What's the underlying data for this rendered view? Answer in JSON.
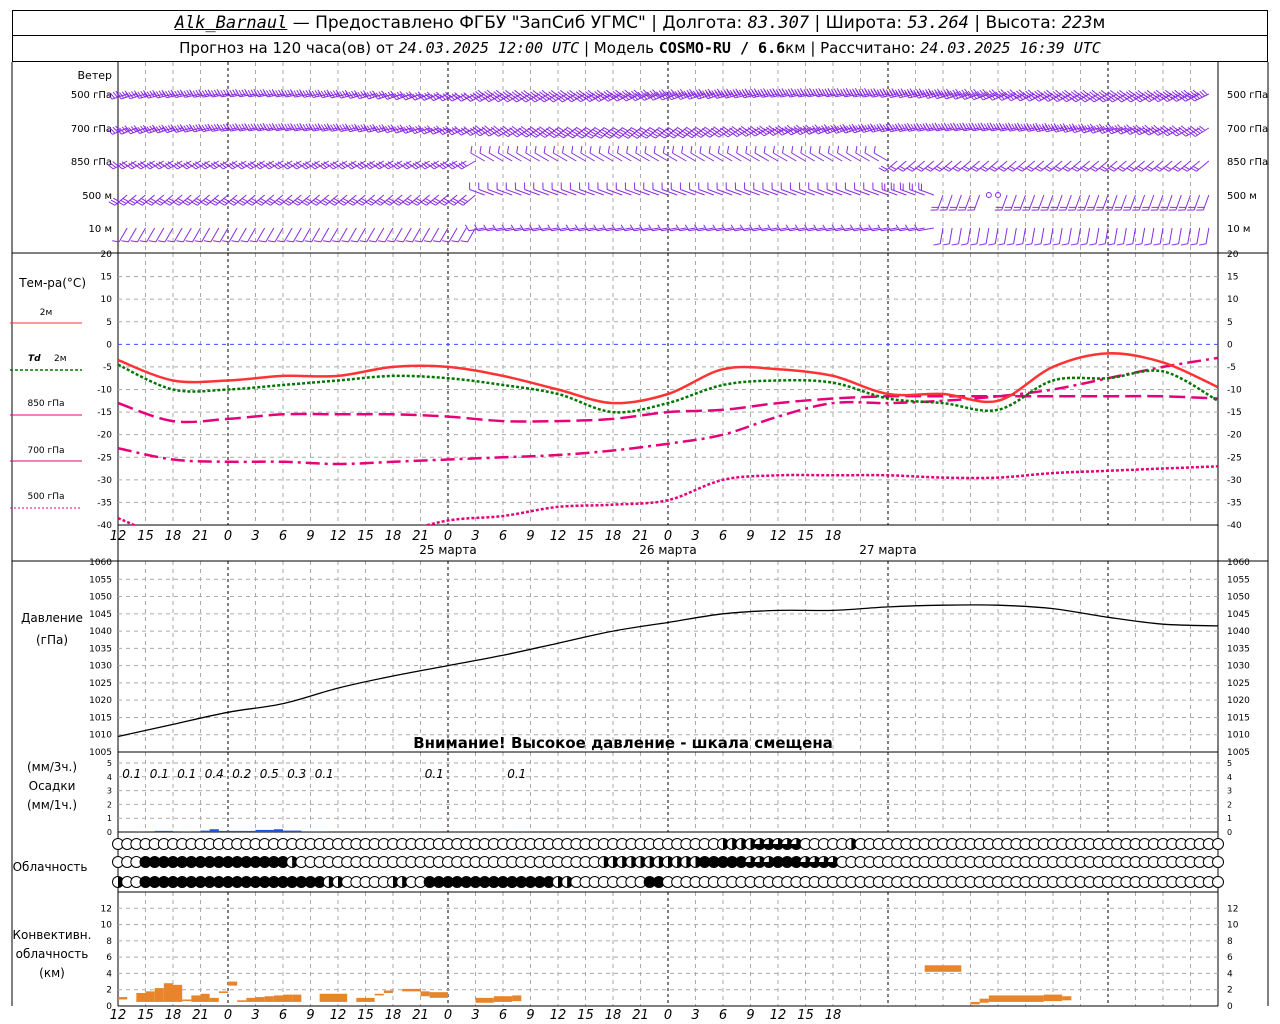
{
  "header": {
    "station": "Alk_Barnaul",
    "provider": " — Предоставлено ФГБУ \"ЗапСиб УГМС\" | Долгота: ",
    "lon": "83.307",
    "lat_label": " | Широта: ",
    "lat": "53.264",
    "alt_label": " | Высота: ",
    "alt": "223",
    "alt_unit": "м",
    "line2_a": "Прогноз на 120 часа(ов) от ",
    "start": "24.03.2025 12:00 UTC",
    "line2_b": "  | Модель ",
    "model": "COSMO-RU / 6.6",
    "model_unit": "км",
    "line2_c": " | Рассчитано: ",
    "computed": "24.03.2025 16:39 UTC"
  },
  "chart_data": [
    {
      "type": "line",
      "panel": "wind",
      "title": "Ветер",
      "levels": [
        "500 гПа",
        "700 гПа",
        "850 гПа",
        "500 м",
        "10  м"
      ]
    },
    {
      "type": "line",
      "panel": "temperature",
      "ylabel": "Тем-ра(°C)",
      "ylim": [
        -40,
        20
      ],
      "yticks": [
        20,
        15,
        10,
        5,
        0,
        -5,
        -10,
        -15,
        -20,
        -25,
        -30,
        -35,
        -40
      ],
      "x_hours": [
        0,
        6,
        12,
        18,
        24,
        30,
        36,
        42,
        48,
        54,
        60,
        66,
        72,
        78,
        84,
        90,
        96,
        102,
        108,
        114,
        120
      ],
      "series": [
        {
          "name": "2м",
          "color": "#ff3333",
          "style": "solid",
          "values": [
            -3.5,
            -8,
            -8,
            -7,
            -7,
            -5,
            -5,
            -7,
            -10,
            -13,
            -11,
            -5.5,
            -5.5,
            -7,
            -11,
            -11,
            -12.5,
            -5,
            -2,
            -4,
            -9.5
          ]
        },
        {
          "name": "Td 2м",
          "color": "#007700",
          "style": "dotted",
          "values": [
            -4.5,
            -10,
            -10,
            -9,
            -8,
            -7,
            -7.5,
            -9,
            -11,
            -15,
            -13,
            -9,
            -8,
            -8.5,
            -12,
            -13,
            -14.5,
            -8,
            -7.5,
            -6,
            -12.5
          ]
        },
        {
          "name": "850 гПа",
          "color": "#e6007a",
          "style": "dash",
          "values": [
            -13,
            -17,
            -16.5,
            -15.5,
            -15.5,
            -15.5,
            -16,
            -17,
            -17,
            -16.5,
            -15,
            -14.5,
            -13,
            -12,
            -11.5,
            -11.5,
            -11.5,
            -11.5,
            -11.5,
            -11.5,
            -12
          ]
        },
        {
          "name": "700 гПа",
          "color": "#e6007a",
          "style": "dashdot",
          "values": [
            -23,
            -25.5,
            -26,
            -26,
            -26.5,
            -26,
            -25.5,
            -25,
            -24.5,
            -23.5,
            -22,
            -20,
            -16,
            -13,
            -13,
            -12.5,
            -11.5,
            -10,
            -7.5,
            -5,
            -3
          ]
        },
        {
          "name": "500 гПа",
          "color": "#e6007a",
          "style": "dotted",
          "values": [
            -38.5,
            -43,
            -43,
            -44,
            -44,
            -42,
            -39,
            -38,
            -36,
            -35.5,
            -34.5,
            -30,
            -29,
            -29,
            -29,
            -29.5,
            -29.5,
            -28.5,
            -28,
            -27.5,
            -27
          ]
        }
      ]
    },
    {
      "type": "line",
      "panel": "pressure",
      "ylabel": "Давление (гПа)",
      "ylim": [
        1005,
        1060
      ],
      "yticks": [
        1060,
        1055,
        1050,
        1045,
        1040,
        1035,
        1030,
        1025,
        1020,
        1015,
        1010,
        1005
      ],
      "note": "Внимание! Высокое давление - шкала смещена",
      "x_hours": [
        0,
        6,
        12,
        18,
        24,
        30,
        36,
        42,
        48,
        54,
        60,
        66,
        72,
        78,
        84,
        90,
        96,
        102,
        108,
        114,
        120
      ],
      "values": [
        1009.5,
        1013,
        1016.5,
        1019,
        1023.5,
        1027,
        1030,
        1033,
        1036.5,
        1040,
        1042.5,
        1045,
        1046,
        1046,
        1047,
        1047.5,
        1047.5,
        1046.5,
        1044,
        1042,
        1041.5
      ]
    },
    {
      "type": "bar",
      "panel": "precipitation",
      "ylabel": "(мм/3ч.) Осадки (мм/1ч.)",
      "ylim": [
        0,
        5
      ],
      "yticks": [
        5,
        4,
        3,
        2,
        1,
        0
      ],
      "labels_3h": [
        {
          "h": 1.5,
          "v": "0.1"
        },
        {
          "h": 4.5,
          "v": "0.1"
        },
        {
          "h": 7.5,
          "v": "0.1"
        },
        {
          "h": 10.5,
          "v": "0.4"
        },
        {
          "h": 13.5,
          "v": "0.2"
        },
        {
          "h": 16.5,
          "v": "0.5"
        },
        {
          "h": 19.5,
          "v": "0.3"
        },
        {
          "h": 22.5,
          "v": "0.1"
        },
        {
          "h": 34.5,
          "v": "0.1"
        },
        {
          "h": 43.5,
          "v": "0.1"
        }
      ],
      "values_1h": [
        {
          "h0": 2,
          "h1": 3,
          "v": 0.05
        },
        {
          "h0": 4,
          "h1": 6,
          "v": 0.08
        },
        {
          "h0": 7,
          "h1": 8,
          "v": 0.05
        },
        {
          "h0": 9,
          "h1": 10,
          "v": 0.1
        },
        {
          "h0": 10,
          "h1": 11,
          "v": 0.2
        },
        {
          "h0": 11,
          "h1": 13,
          "v": 0.08
        },
        {
          "h0": 13,
          "h1": 15,
          "v": 0.08
        },
        {
          "h0": 15,
          "h1": 17,
          "v": 0.15
        },
        {
          "h0": 17,
          "h1": 18,
          "v": 0.2
        },
        {
          "h0": 18,
          "h1": 20,
          "v": 0.1
        },
        {
          "h0": 20,
          "h1": 23,
          "v": 0.05
        },
        {
          "h0": 34,
          "h1": 35,
          "v": 0.05
        },
        {
          "h0": 43,
          "h1": 45,
          "v": 0.05
        }
      ],
      "color": "#1f4fe0"
    },
    {
      "type": "table",
      "panel": "cloudiness",
      "ylabel": "Облачность",
      "rows": [
        {
          "level": "high",
          "runs": [
            [
              0,
              65,
              0
            ],
            [
              66,
              70,
              2
            ],
            [
              70,
              75,
              3
            ],
            [
              75,
              80,
              0
            ],
            [
              80,
              81,
              2
            ],
            [
              81,
              121,
              0
            ]
          ]
        },
        {
          "level": "middle",
          "runs": [
            [
              0,
              3,
              0
            ],
            [
              3,
              19,
              4
            ],
            [
              19,
              20,
              2
            ],
            [
              20,
              53,
              0
            ],
            [
              53,
              64,
              2
            ],
            [
              64,
              69,
              4
            ],
            [
              69,
              72,
              3
            ],
            [
              72,
              75,
              4
            ],
            [
              75,
              79,
              3
            ],
            [
              79,
              121,
              0
            ]
          ]
        },
        {
          "level": "low",
          "runs": [
            [
              0,
              1,
              2
            ],
            [
              1,
              3,
              0
            ],
            [
              3,
              23,
              4
            ],
            [
              23,
              25,
              2
            ],
            [
              25,
              30,
              0
            ],
            [
              30,
              32,
              2
            ],
            [
              32,
              34,
              0
            ],
            [
              34,
              48,
              4
            ],
            [
              48,
              50,
              2
            ],
            [
              50,
              58,
              0
            ],
            [
              58,
              60,
              4
            ],
            [
              60,
              121,
              0
            ]
          ]
        }
      ]
    },
    {
      "type": "bar",
      "panel": "convective",
      "ylabel": "Конвективн. облачность (км)",
      "ylim": [
        0,
        14
      ],
      "yticks": [
        12,
        10,
        8,
        6,
        4,
        2,
        0
      ],
      "color": "#e8852a",
      "bars": [
        {
          "h0": 0,
          "h1": 1,
          "lo": 0.8,
          "hi": 1.1
        },
        {
          "h0": 2,
          "h1": 3,
          "lo": 0.5,
          "hi": 1.6
        },
        {
          "h0": 3,
          "h1": 4,
          "lo": 0.5,
          "hi": 1.8
        },
        {
          "h0": 4,
          "h1": 5,
          "lo": 0.5,
          "hi": 2.2
        },
        {
          "h0": 5,
          "h1": 6,
          "lo": 0.5,
          "hi": 2.8
        },
        {
          "h0": 6,
          "h1": 7,
          "lo": 0.5,
          "hi": 2.6
        },
        {
          "h0": 7,
          "h1": 8,
          "lo": 0.6,
          "hi": 0.8
        },
        {
          "h0": 8,
          "h1": 9,
          "lo": 0.5,
          "hi": 1.3
        },
        {
          "h0": 9,
          "h1": 10,
          "lo": 0.5,
          "hi": 1.5
        },
        {
          "h0": 10,
          "h1": 11,
          "lo": 0.5,
          "hi": 1.0
        },
        {
          "h0": 11,
          "h1": 12,
          "lo": 1.6,
          "hi": 1.8
        },
        {
          "h0": 12,
          "h1": 13,
          "lo": 2.5,
          "hi": 3.0
        },
        {
          "h0": 13,
          "h1": 14,
          "lo": 0.5,
          "hi": 0.7
        },
        {
          "h0": 14,
          "h1": 15,
          "lo": 0.5,
          "hi": 1.0
        },
        {
          "h0": 15,
          "h1": 16,
          "lo": 0.5,
          "hi": 1.1
        },
        {
          "h0": 16,
          "h1": 17,
          "lo": 0.5,
          "hi": 1.2
        },
        {
          "h0": 17,
          "h1": 18,
          "lo": 0.5,
          "hi": 1.3
        },
        {
          "h0": 18,
          "h1": 19,
          "lo": 0.5,
          "hi": 1.4
        },
        {
          "h0": 19,
          "h1": 20,
          "lo": 0.5,
          "hi": 1.4
        },
        {
          "h0": 22,
          "h1": 25,
          "lo": 0.5,
          "hi": 1.5
        },
        {
          "h0": 26,
          "h1": 28,
          "lo": 0.5,
          "hi": 1.0
        },
        {
          "h0": 28,
          "h1": 29,
          "lo": 1.3,
          "hi": 1.5
        },
        {
          "h0": 29,
          "h1": 30,
          "lo": 1.6,
          "hi": 1.9
        },
        {
          "h0": 31,
          "h1": 33,
          "lo": 1.8,
          "hi": 2.1
        },
        {
          "h0": 33,
          "h1": 34,
          "lo": 1.2,
          "hi": 1.8
        },
        {
          "h0": 34,
          "h1": 36,
          "lo": 1.0,
          "hi": 1.7
        },
        {
          "h0": 39,
          "h1": 41,
          "lo": 0.4,
          "hi": 1.0
        },
        {
          "h0": 41,
          "h1": 43,
          "lo": 0.5,
          "hi": 1.2
        },
        {
          "h0": 43,
          "h1": 44,
          "lo": 0.6,
          "hi": 1.3
        },
        {
          "h0": 88,
          "h1": 92,
          "lo": 4.2,
          "hi": 5.0
        },
        {
          "h0": 93,
          "h1": 94,
          "lo": 0.2,
          "hi": 0.5
        },
        {
          "h0": 94,
          "h1": 95,
          "lo": 0.4,
          "hi": 0.9
        },
        {
          "h0": 95,
          "h1": 101,
          "lo": 0.5,
          "hi": 1.3
        },
        {
          "h0": 101,
          "h1": 103,
          "lo": 0.6,
          "hi": 1.4
        },
        {
          "h0": 103,
          "h1": 104,
          "lo": 0.7,
          "hi": 1.2
        }
      ]
    }
  ],
  "x_axis": {
    "tick_labels": [
      "12",
      "15",
      "18",
      "21",
      "0",
      "3",
      "6",
      "9",
      "12",
      "15",
      "18",
      "21",
      "0",
      "3",
      "6",
      "9",
      "12",
      "15",
      "18",
      "21",
      "0",
      "3",
      "6",
      "9",
      "12",
      "15",
      "18"
    ],
    "dates": [
      {
        "h": 36,
        "text": "25 марта"
      },
      {
        "h": 60,
        "text": "26 марта"
      },
      {
        "h": 84,
        "text": "27 марта"
      }
    ]
  },
  "legend": {
    "t2m": "2м",
    "td_prefix": "Td",
    "td2m": "2м",
    "t850": "850 гПа",
    "t700": "700 гПа",
    "t500": "500 гПа"
  },
  "colors": {
    "wind": "#8a2be2",
    "grid": "#aaaaaa",
    "zero_line": "#3355ff"
  }
}
